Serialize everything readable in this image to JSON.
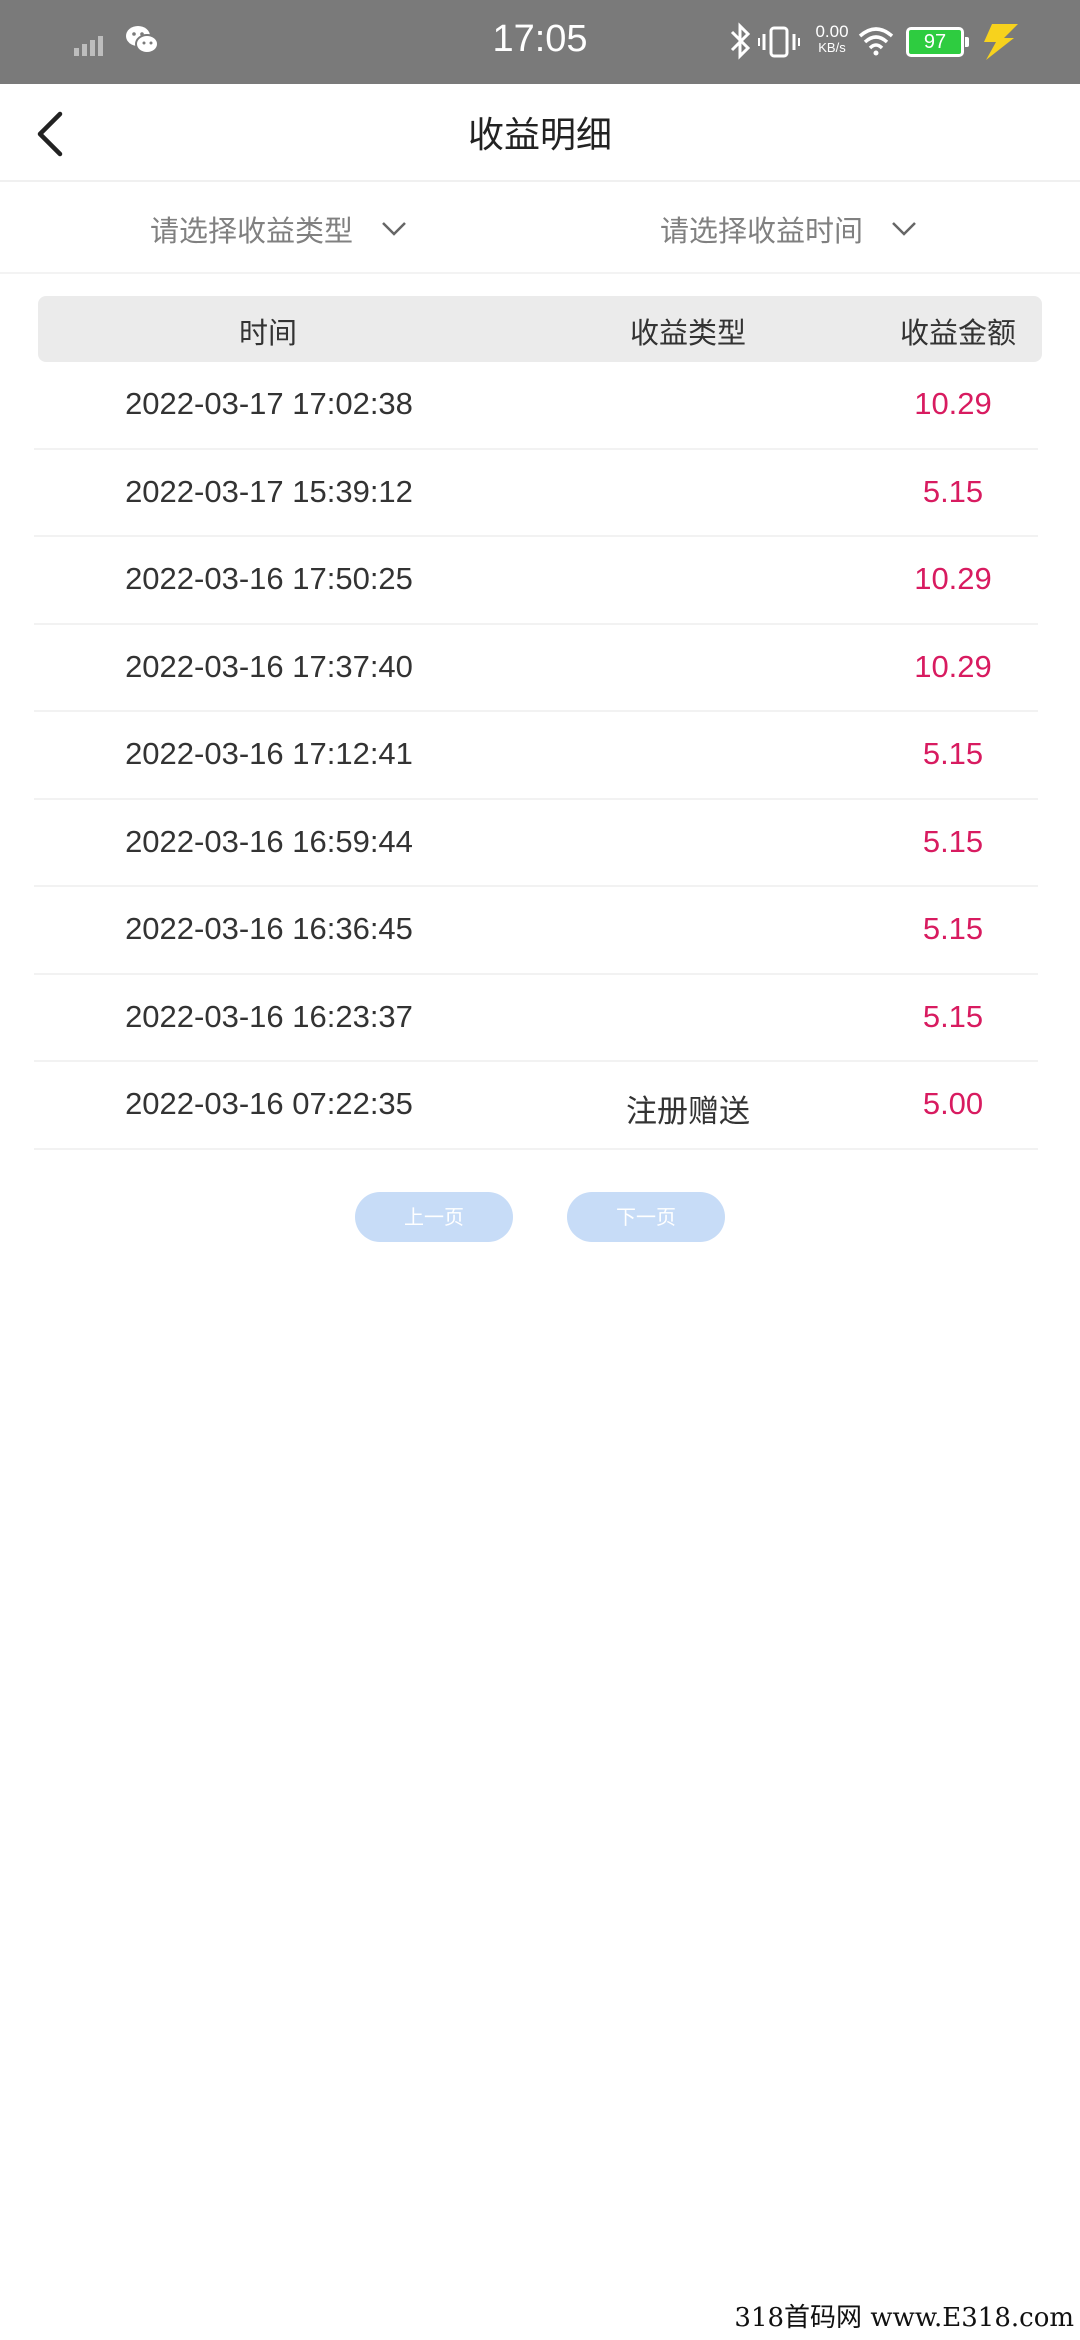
{
  "status_bar": {
    "time": "17:05",
    "net_speed_value": "0.00",
    "net_speed_unit": "KB/s",
    "battery": "97"
  },
  "header": {
    "title": "收益明细"
  },
  "filters": {
    "type_placeholder": "请选择收益类型",
    "time_placeholder": "请选择收益时间"
  },
  "table": {
    "headers": [
      "时间",
      "收益类型",
      "收益金额"
    ],
    "rows": [
      {
        "time": "2022-03-17 17:02:38",
        "type": "",
        "amount": "10.29"
      },
      {
        "time": "2022-03-17 15:39:12",
        "type": "",
        "amount": "5.15"
      },
      {
        "time": "2022-03-16 17:50:25",
        "type": "",
        "amount": "10.29"
      },
      {
        "time": "2022-03-16 17:37:40",
        "type": "",
        "amount": "10.29"
      },
      {
        "time": "2022-03-16 17:12:41",
        "type": "",
        "amount": "5.15"
      },
      {
        "time": "2022-03-16 16:59:44",
        "type": "",
        "amount": "5.15"
      },
      {
        "time": "2022-03-16 16:36:45",
        "type": "",
        "amount": "5.15"
      },
      {
        "time": "2022-03-16 16:23:37",
        "type": "",
        "amount": "5.15"
      },
      {
        "time": "2022-03-16 07:22:35",
        "type": "注册赠送",
        "amount": "5.00"
      }
    ]
  },
  "pagination": {
    "prev_label": "上一页",
    "next_label": "下一页"
  },
  "watermark": "318首码网 www.E318.com",
  "colors": {
    "amount": "#d81b60",
    "pager_button": "#c7dcf7",
    "status_bar": "#7a7a7a",
    "battery": "#2ecc40"
  },
  "icons": [
    "signal-icon",
    "wechat-icon",
    "bluetooth-icon",
    "vibrate-icon",
    "wifi-icon",
    "battery-icon",
    "charging-icon",
    "back-arrow-icon",
    "chevron-down-icon"
  ]
}
